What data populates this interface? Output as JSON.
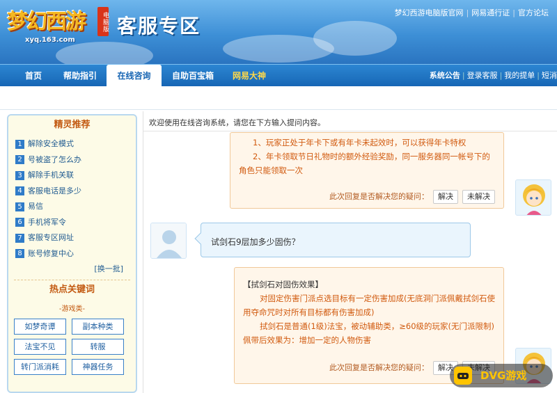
{
  "header": {
    "logo_text": "梦幻西游",
    "logo_badge": "电脑版",
    "logo_url": "xyq.163.com",
    "site_title": "客服专区",
    "top_links": [
      "梦幻西游电脑版官网",
      "网易通行证",
      "官方论坛"
    ]
  },
  "nav": {
    "tabs": [
      {
        "label": "首页"
      },
      {
        "label": "帮助指引"
      },
      {
        "label": "在线咨询",
        "active": true
      },
      {
        "label": "自助百宝箱"
      },
      {
        "label": "网易大神",
        "highlight": true
      }
    ],
    "right_links": [
      "系统公告",
      "登录客服",
      "我的提单",
      "短消"
    ]
  },
  "sidebar": {
    "recommend_title": "精灵推荐",
    "items": [
      {
        "num": "1",
        "label": "解除安全模式"
      },
      {
        "num": "2",
        "label": "号被盗了怎么办"
      },
      {
        "num": "3",
        "label": "解除手机关联"
      },
      {
        "num": "4",
        "label": "客服电话是多少"
      },
      {
        "num": "5",
        "label": "易信"
      },
      {
        "num": "6",
        "label": "手机将军令"
      },
      {
        "num": "7",
        "label": "客服专区网址"
      },
      {
        "num": "8",
        "label": "账号修复中心"
      }
    ],
    "more_label": "[换一批]",
    "hot_title": "热点关键词",
    "category": "-游戏类-",
    "keywords": [
      "如梦奇谭",
      "副本种类",
      "法宝不见",
      "转服",
      "转门派消耗",
      "神器任务"
    ]
  },
  "chat": {
    "welcome": "欢迎使用在线咨询系统，请您在下方输入提问内容。",
    "bot_answer_1": {
      "lines": [
        "1、玩家正处于年卡下或有年卡未起效时，可以获得年卡特权",
        "2、年卡领取节日礼物时的额外经验奖励，同一服务器同一帐号下的角色只能领取一次"
      ]
    },
    "feedback": {
      "question": "此次回复是否解决您的疑问：",
      "solved": "解决",
      "unsolved": "未解决"
    },
    "user_question": "试剑石9层加多少固伤？",
    "bot_answer_2": {
      "title": "【拭剑石对固伤效果】",
      "lines": [
        "对固定伤害门派点选目标有一定伤害加成(无底洞门派佩戴拭剑石使用夺命咒时对所有目标都有伤害加成)",
        "拭剑石是普通(1级)法宝，被动辅助类，≥60级的玩家(无门派限制)佩带后效果为：增加一定的人物伤害"
      ]
    }
  },
  "watermark": "DVG游戏",
  "colors": {
    "banner_blue": "#3d8fd6",
    "nav_blue": "#1766b5",
    "bot_orange": "#d15a0f",
    "sidebar_bg": "#fdfbe7"
  }
}
